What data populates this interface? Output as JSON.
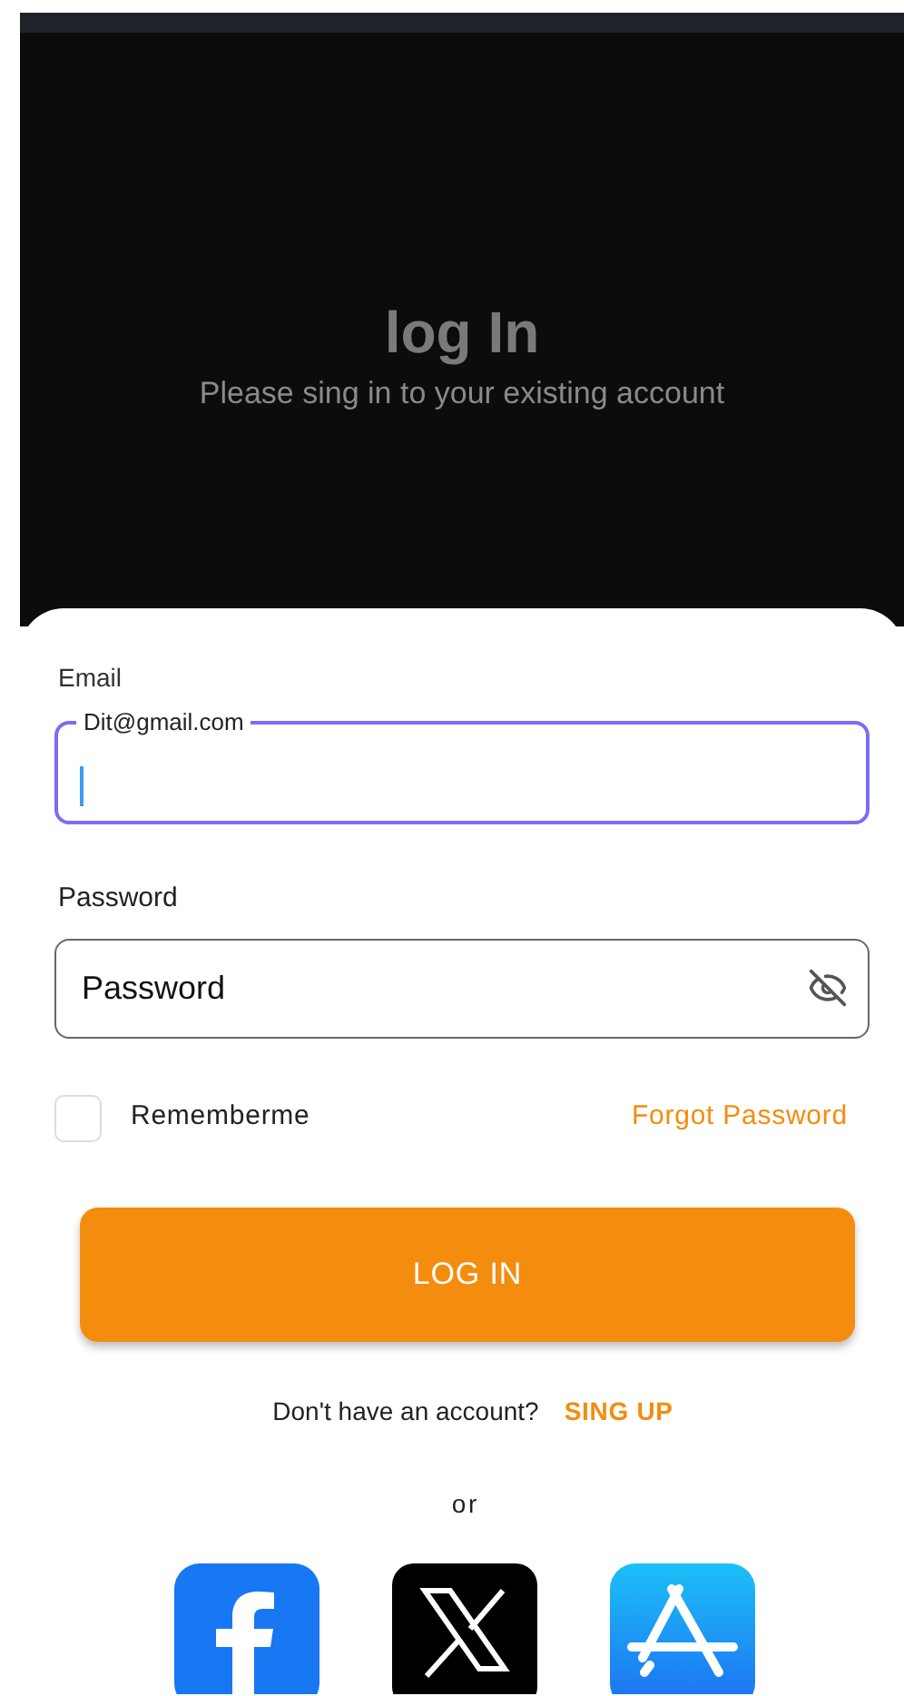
{
  "header": {
    "title": "log In",
    "subtitle": "Please sing in to your existing account"
  },
  "email": {
    "label": "Email",
    "floating_label": "Dit@gmail.com",
    "focused": true
  },
  "password": {
    "label": "Password",
    "placeholder": "Password",
    "visible": false
  },
  "remember": {
    "label": "Rememberme",
    "checked": false
  },
  "forgot_link": "Forgot Password",
  "login_button": "LOG IN",
  "signup": {
    "prompt": "Don't have an account?",
    "link": "SING UP"
  },
  "divider": "or",
  "social": [
    {
      "kind": "facebook"
    },
    {
      "kind": "x"
    },
    {
      "kind": "appstore"
    }
  ]
}
